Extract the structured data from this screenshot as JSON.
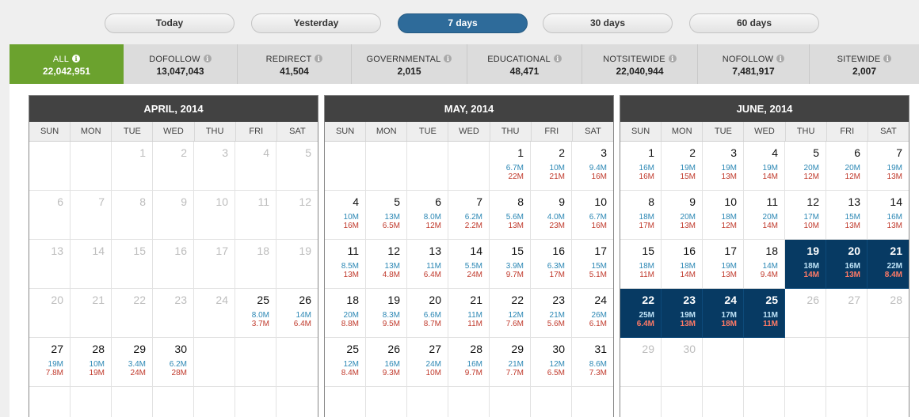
{
  "tabs": [
    "Today",
    "Yesterday",
    "7 days",
    "30 days",
    "60 days"
  ],
  "active_tab": "7 days",
  "filters": [
    {
      "name": "ALL",
      "value": "22,042,951"
    },
    {
      "name": "DOFOLLOW",
      "value": "13,047,043"
    },
    {
      "name": "REDIRECT",
      "value": "41,504"
    },
    {
      "name": "GOVERNMENTAL",
      "value": "2,015"
    },
    {
      "name": "EDUCATIONAL",
      "value": "48,471"
    },
    {
      "name": "NOTSITEWIDE",
      "value": "22,040,944"
    },
    {
      "name": "NOFOLLOW",
      "value": "7,481,917"
    },
    {
      "name": "SITEWIDE",
      "value": "2,007"
    }
  ],
  "active_filter": "ALL",
  "info_icon": "i",
  "weekdays": [
    "SUN",
    "MON",
    "TUE",
    "WED",
    "THU",
    "FRI",
    "SAT"
  ],
  "colors": {
    "new": "#2b87b4",
    "lost": "#c0392b",
    "selected": "#073a63",
    "active_filter": "#6ba22e",
    "active_tab": "#2e6b9a"
  },
  "months": [
    {
      "title": "APRIL, 2014",
      "weeks": [
        [
          {
            "d": ""
          },
          {
            "d": ""
          },
          {
            "d": "1",
            "o": true
          },
          {
            "d": "2",
            "o": true
          },
          {
            "d": "3",
            "o": true
          },
          {
            "d": "4",
            "o": true
          },
          {
            "d": "5",
            "o": true
          }
        ],
        [
          {
            "d": "6",
            "o": true
          },
          {
            "d": "7",
            "o": true
          },
          {
            "d": "8",
            "o": true
          },
          {
            "d": "9",
            "o": true
          },
          {
            "d": "10",
            "o": true
          },
          {
            "d": "11",
            "o": true
          },
          {
            "d": "12",
            "o": true
          }
        ],
        [
          {
            "d": "13",
            "o": true
          },
          {
            "d": "14",
            "o": true
          },
          {
            "d": "15",
            "o": true
          },
          {
            "d": "16",
            "o": true
          },
          {
            "d": "17",
            "o": true
          },
          {
            "d": "18",
            "o": true
          },
          {
            "d": "19",
            "o": true
          }
        ],
        [
          {
            "d": "20",
            "o": true
          },
          {
            "d": "21",
            "o": true
          },
          {
            "d": "22",
            "o": true
          },
          {
            "d": "23",
            "o": true
          },
          {
            "d": "24",
            "o": true
          },
          {
            "d": "25",
            "a": "8.0M",
            "b": "3.7M"
          },
          {
            "d": "26",
            "a": "14M",
            "b": "6.4M"
          }
        ],
        [
          {
            "d": "27",
            "a": "19M",
            "b": "7.8M"
          },
          {
            "d": "28",
            "a": "10M",
            "b": "19M"
          },
          {
            "d": "29",
            "a": "3.4M",
            "b": "24M"
          },
          {
            "d": "30",
            "a": "6.2M",
            "b": "28M"
          },
          {
            "d": ""
          },
          {
            "d": ""
          },
          {
            "d": ""
          }
        ],
        [
          {
            "d": ""
          },
          {
            "d": ""
          },
          {
            "d": ""
          },
          {
            "d": ""
          },
          {
            "d": ""
          },
          {
            "d": ""
          },
          {
            "d": ""
          }
        ]
      ]
    },
    {
      "title": "MAY, 2014",
      "weeks": [
        [
          {
            "d": ""
          },
          {
            "d": ""
          },
          {
            "d": ""
          },
          {
            "d": ""
          },
          {
            "d": "1",
            "a": "6.7M",
            "b": "22M"
          },
          {
            "d": "2",
            "a": "10M",
            "b": "21M"
          },
          {
            "d": "3",
            "a": "9.4M",
            "b": "16M"
          }
        ],
        [
          {
            "d": "4",
            "a": "10M",
            "b": "16M"
          },
          {
            "d": "5",
            "a": "13M",
            "b": "6.5M"
          },
          {
            "d": "6",
            "a": "8.0M",
            "b": "12M"
          },
          {
            "d": "7",
            "a": "6.2M",
            "b": "2.2M"
          },
          {
            "d": "8",
            "a": "5.6M",
            "b": "13M"
          },
          {
            "d": "9",
            "a": "4.0M",
            "b": "23M"
          },
          {
            "d": "10",
            "a": "6.7M",
            "b": "16M"
          }
        ],
        [
          {
            "d": "11",
            "a": "8.5M",
            "b": "13M"
          },
          {
            "d": "12",
            "a": "13M",
            "b": "4.8M"
          },
          {
            "d": "13",
            "a": "11M",
            "b": "6.4M"
          },
          {
            "d": "14",
            "a": "5.5M",
            "b": "24M"
          },
          {
            "d": "15",
            "a": "3.9M",
            "b": "9.7M"
          },
          {
            "d": "16",
            "a": "6.3M",
            "b": "17M"
          },
          {
            "d": "17",
            "a": "15M",
            "b": "5.1M"
          }
        ],
        [
          {
            "d": "18",
            "a": "20M",
            "b": "8.8M"
          },
          {
            "d": "19",
            "a": "8.3M",
            "b": "9.5M"
          },
          {
            "d": "20",
            "a": "6.6M",
            "b": "8.7M"
          },
          {
            "d": "21",
            "a": "11M",
            "b": "11M"
          },
          {
            "d": "22",
            "a": "12M",
            "b": "7.6M"
          },
          {
            "d": "23",
            "a": "21M",
            "b": "5.6M"
          },
          {
            "d": "24",
            "a": "26M",
            "b": "6.1M"
          }
        ],
        [
          {
            "d": "25",
            "a": "12M",
            "b": "8.4M"
          },
          {
            "d": "26",
            "a": "16M",
            "b": "9.3M"
          },
          {
            "d": "27",
            "a": "24M",
            "b": "10M"
          },
          {
            "d": "28",
            "a": "16M",
            "b": "9.7M"
          },
          {
            "d": "29",
            "a": "21M",
            "b": "7.7M"
          },
          {
            "d": "30",
            "a": "12M",
            "b": "6.5M"
          },
          {
            "d": "31",
            "a": "8.6M",
            "b": "7.3M"
          }
        ],
        [
          {
            "d": ""
          },
          {
            "d": ""
          },
          {
            "d": ""
          },
          {
            "d": ""
          },
          {
            "d": ""
          },
          {
            "d": ""
          },
          {
            "d": ""
          }
        ]
      ]
    },
    {
      "title": "JUNE, 2014",
      "weeks": [
        [
          {
            "d": "1",
            "a": "16M",
            "b": "16M"
          },
          {
            "d": "2",
            "a": "19M",
            "b": "15M"
          },
          {
            "d": "3",
            "a": "19M",
            "b": "13M"
          },
          {
            "d": "4",
            "a": "19M",
            "b": "14M"
          },
          {
            "d": "5",
            "a": "20M",
            "b": "12M"
          },
          {
            "d": "6",
            "a": "20M",
            "b": "12M"
          },
          {
            "d": "7",
            "a": "19M",
            "b": "13M"
          }
        ],
        [
          {
            "d": "8",
            "a": "18M",
            "b": "17M"
          },
          {
            "d": "9",
            "a": "20M",
            "b": "13M"
          },
          {
            "d": "10",
            "a": "18M",
            "b": "12M"
          },
          {
            "d": "11",
            "a": "20M",
            "b": "14M"
          },
          {
            "d": "12",
            "a": "17M",
            "b": "10M"
          },
          {
            "d": "13",
            "a": "15M",
            "b": "13M"
          },
          {
            "d": "14",
            "a": "16M",
            "b": "13M"
          }
        ],
        [
          {
            "d": "15",
            "a": "18M",
            "b": "11M"
          },
          {
            "d": "16",
            "a": "18M",
            "b": "14M"
          },
          {
            "d": "17",
            "a": "19M",
            "b": "13M"
          },
          {
            "d": "18",
            "a": "14M",
            "b": "9.4M"
          },
          {
            "d": "19",
            "a": "18M",
            "b": "14M",
            "s": true
          },
          {
            "d": "20",
            "a": "16M",
            "b": "13M",
            "s": true
          },
          {
            "d": "21",
            "a": "22M",
            "b": "8.4M",
            "s": true
          }
        ],
        [
          {
            "d": "22",
            "a": "25M",
            "b": "6.4M",
            "s": true
          },
          {
            "d": "23",
            "a": "19M",
            "b": "13M",
            "s": true
          },
          {
            "d": "24",
            "a": "17M",
            "b": "18M",
            "s": true
          },
          {
            "d": "25",
            "a": "11M",
            "b": "11M",
            "s": true
          },
          {
            "d": "26",
            "o": true
          },
          {
            "d": "27",
            "o": true
          },
          {
            "d": "28",
            "o": true
          }
        ],
        [
          {
            "d": "29",
            "o": true
          },
          {
            "d": "30",
            "o": true
          },
          {
            "d": ""
          },
          {
            "d": ""
          },
          {
            "d": ""
          },
          {
            "d": ""
          },
          {
            "d": ""
          }
        ],
        [
          {
            "d": ""
          },
          {
            "d": ""
          },
          {
            "d": ""
          },
          {
            "d": ""
          },
          {
            "d": ""
          },
          {
            "d": ""
          },
          {
            "d": ""
          }
        ]
      ]
    }
  ]
}
